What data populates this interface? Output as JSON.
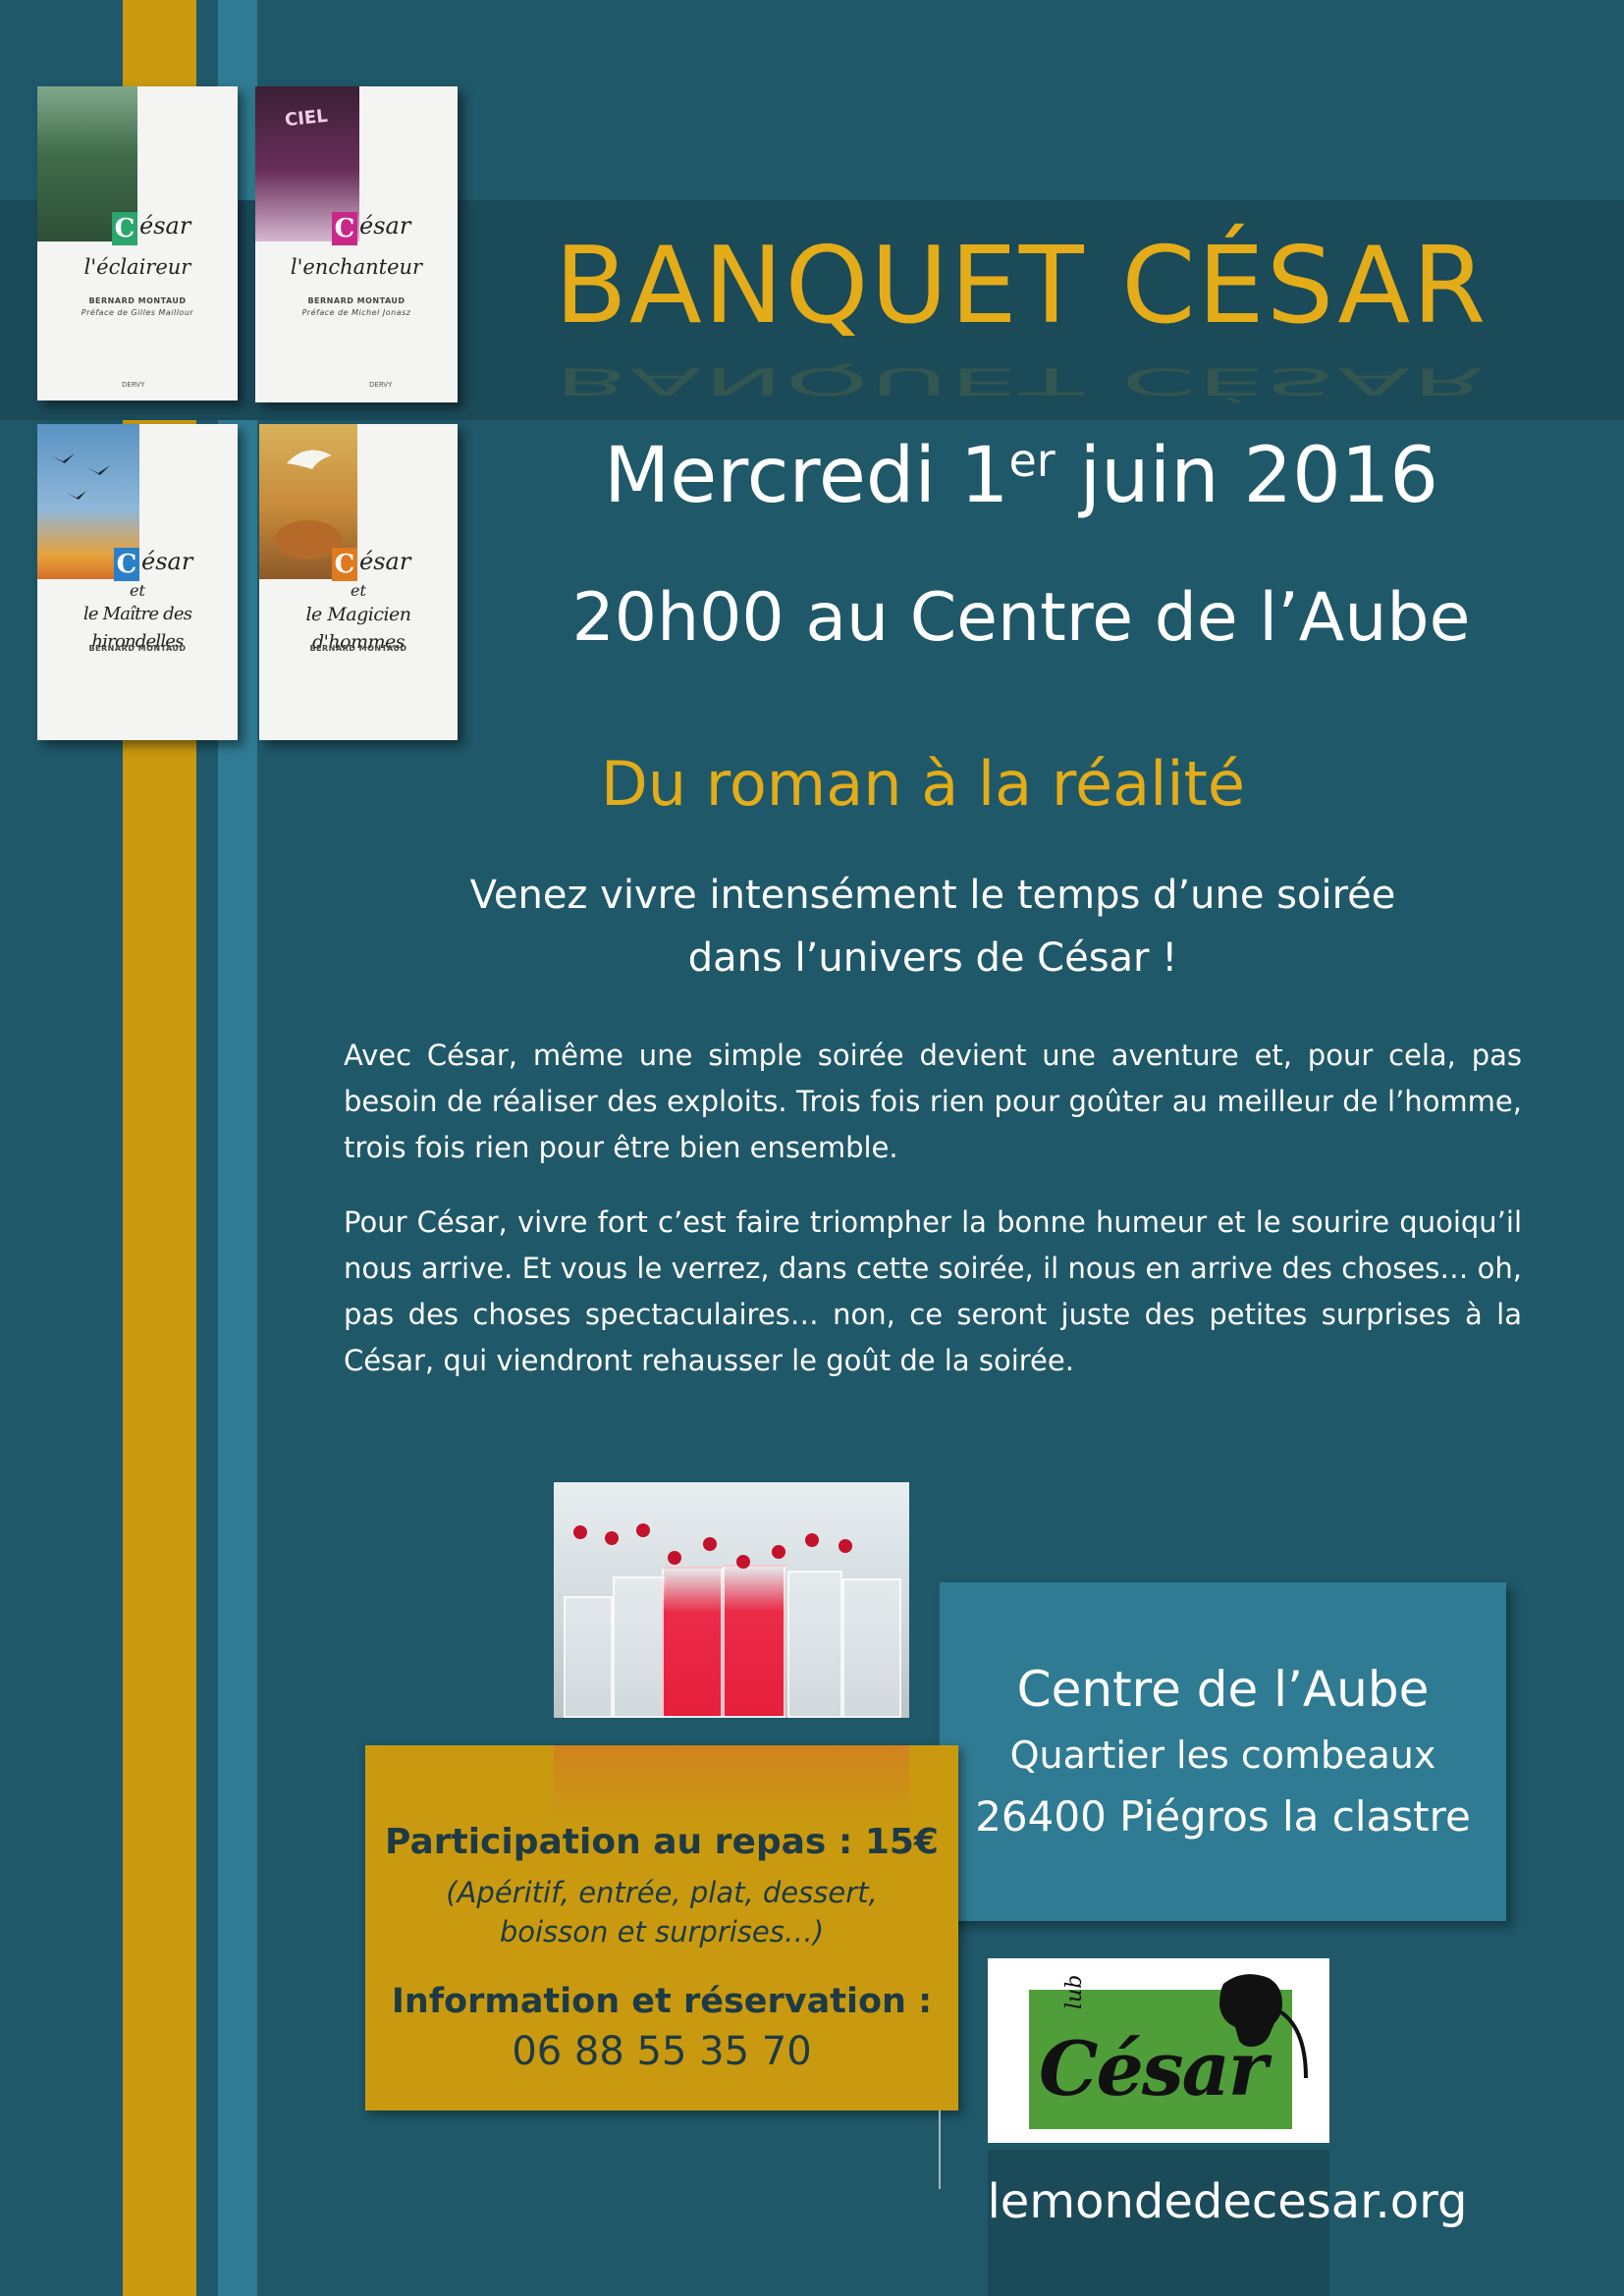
{
  "books": [
    {
      "letter": "C",
      "rest": "ésar",
      "line2": "l'éclaireur",
      "author": "BERNARD MONTAUD",
      "preface": "Préface de Gilles Maillour",
      "publisher": "DERVY",
      "accent": "#2aa56b"
    },
    {
      "letter": "C",
      "rest": "ésar",
      "line2": "l'enchanteur",
      "author": "BERNARD MONTAUD",
      "preface": "Préface de Michel Jonasz",
      "publisher": "DERVY",
      "accent": "#c8288a",
      "hopscotch": "CIEL"
    },
    {
      "letter": "C",
      "rest": "ésar",
      "line2": "et",
      "line3": "le Maître des hirondelles",
      "author": "BERNARD MONTAUD",
      "accent": "#2a7fc8"
    },
    {
      "letter": "C",
      "rest": "ésar",
      "line2": "et",
      "line3": "le Magicien d'hommes",
      "author": "BERNARD MONTAUD",
      "accent": "#e07a1f"
    }
  ],
  "event": {
    "title": "BANQUET CÉSAR",
    "date_before": "Mercredi 1",
    "date_sup": "er",
    "date_after": " juin 2016",
    "time_place": "20h00 au Centre de l’Aube",
    "subtitle": "Du roman à la réalité",
    "tagline_1": "Venez vivre intensément le temps d’une soirée",
    "tagline_2": "dans l’univers de César !",
    "paragraph_1": "Avec César, même une simple soirée devient une aventure et, pour cela, pas besoin de réaliser des exploits. Trois fois rien pour goûter au meilleur de l’homme, trois fois rien pour être bien ensemble.",
    "paragraph_2": "Pour César, vivre fort c’est faire triompher la bonne humeur et le sourire quoiqu’il nous arrive. Et vous le verrez, dans cette soirée, il nous en arrive des choses… oh, pas des choses spectaculaires… non, ce seront juste des petites surprises à la César, qui viendront rehausser le goût de la soirée."
  },
  "price": {
    "label": "Participation au repas : ",
    "amount": "15€",
    "detail_1": "(Apéritif, entrée, plat, dessert,",
    "detail_2": "boisson et surprises…)",
    "info_label": "Information et réservation :",
    "phone": "06 88 55 35 70"
  },
  "address": {
    "name": "Centre de l’Aube",
    "line_1": "Quartier les combeaux",
    "line_2": "26400 Piégros la clastre"
  },
  "logo": {
    "small": "lub",
    "big": "César"
  },
  "website": "lemondedecesar.org",
  "colors": {
    "background": "#1f5869",
    "gold": "#c99a0f",
    "title_gold": "#e3ac18",
    "stripe_blue": "#2f7b93"
  }
}
